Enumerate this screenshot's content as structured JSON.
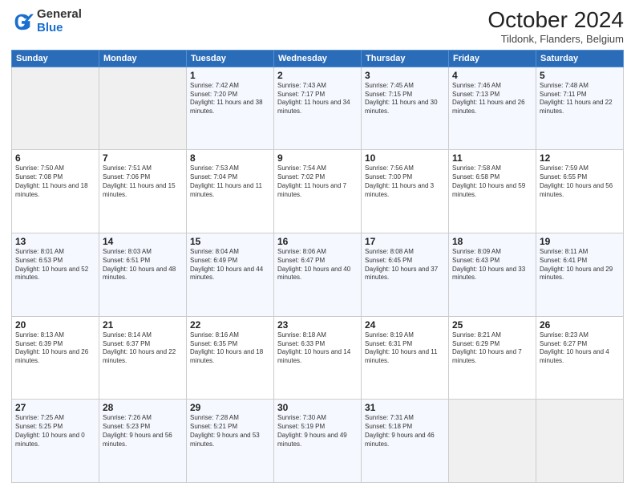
{
  "header": {
    "logo_general": "General",
    "logo_blue": "Blue",
    "month": "October 2024",
    "location": "Tildonk, Flanders, Belgium"
  },
  "days_of_week": [
    "Sunday",
    "Monday",
    "Tuesday",
    "Wednesday",
    "Thursday",
    "Friday",
    "Saturday"
  ],
  "weeks": [
    [
      {
        "day": "",
        "sunrise": "",
        "sunset": "",
        "daylight": "",
        "empty": true
      },
      {
        "day": "",
        "sunrise": "",
        "sunset": "",
        "daylight": "",
        "empty": true
      },
      {
        "day": "1",
        "sunrise": "Sunrise: 7:42 AM",
        "sunset": "Sunset: 7:20 PM",
        "daylight": "Daylight: 11 hours and 38 minutes."
      },
      {
        "day": "2",
        "sunrise": "Sunrise: 7:43 AM",
        "sunset": "Sunset: 7:17 PM",
        "daylight": "Daylight: 11 hours and 34 minutes."
      },
      {
        "day": "3",
        "sunrise": "Sunrise: 7:45 AM",
        "sunset": "Sunset: 7:15 PM",
        "daylight": "Daylight: 11 hours and 30 minutes."
      },
      {
        "day": "4",
        "sunrise": "Sunrise: 7:46 AM",
        "sunset": "Sunset: 7:13 PM",
        "daylight": "Daylight: 11 hours and 26 minutes."
      },
      {
        "day": "5",
        "sunrise": "Sunrise: 7:48 AM",
        "sunset": "Sunset: 7:11 PM",
        "daylight": "Daylight: 11 hours and 22 minutes."
      }
    ],
    [
      {
        "day": "6",
        "sunrise": "Sunrise: 7:50 AM",
        "sunset": "Sunset: 7:08 PM",
        "daylight": "Daylight: 11 hours and 18 minutes."
      },
      {
        "day": "7",
        "sunrise": "Sunrise: 7:51 AM",
        "sunset": "Sunset: 7:06 PM",
        "daylight": "Daylight: 11 hours and 15 minutes."
      },
      {
        "day": "8",
        "sunrise": "Sunrise: 7:53 AM",
        "sunset": "Sunset: 7:04 PM",
        "daylight": "Daylight: 11 hours and 11 minutes."
      },
      {
        "day": "9",
        "sunrise": "Sunrise: 7:54 AM",
        "sunset": "Sunset: 7:02 PM",
        "daylight": "Daylight: 11 hours and 7 minutes."
      },
      {
        "day": "10",
        "sunrise": "Sunrise: 7:56 AM",
        "sunset": "Sunset: 7:00 PM",
        "daylight": "Daylight: 11 hours and 3 minutes."
      },
      {
        "day": "11",
        "sunrise": "Sunrise: 7:58 AM",
        "sunset": "Sunset: 6:58 PM",
        "daylight": "Daylight: 10 hours and 59 minutes."
      },
      {
        "day": "12",
        "sunrise": "Sunrise: 7:59 AM",
        "sunset": "Sunset: 6:55 PM",
        "daylight": "Daylight: 10 hours and 56 minutes."
      }
    ],
    [
      {
        "day": "13",
        "sunrise": "Sunrise: 8:01 AM",
        "sunset": "Sunset: 6:53 PM",
        "daylight": "Daylight: 10 hours and 52 minutes."
      },
      {
        "day": "14",
        "sunrise": "Sunrise: 8:03 AM",
        "sunset": "Sunset: 6:51 PM",
        "daylight": "Daylight: 10 hours and 48 minutes."
      },
      {
        "day": "15",
        "sunrise": "Sunrise: 8:04 AM",
        "sunset": "Sunset: 6:49 PM",
        "daylight": "Daylight: 10 hours and 44 minutes."
      },
      {
        "day": "16",
        "sunrise": "Sunrise: 8:06 AM",
        "sunset": "Sunset: 6:47 PM",
        "daylight": "Daylight: 10 hours and 40 minutes."
      },
      {
        "day": "17",
        "sunrise": "Sunrise: 8:08 AM",
        "sunset": "Sunset: 6:45 PM",
        "daylight": "Daylight: 10 hours and 37 minutes."
      },
      {
        "day": "18",
        "sunrise": "Sunrise: 8:09 AM",
        "sunset": "Sunset: 6:43 PM",
        "daylight": "Daylight: 10 hours and 33 minutes."
      },
      {
        "day": "19",
        "sunrise": "Sunrise: 8:11 AM",
        "sunset": "Sunset: 6:41 PM",
        "daylight": "Daylight: 10 hours and 29 minutes."
      }
    ],
    [
      {
        "day": "20",
        "sunrise": "Sunrise: 8:13 AM",
        "sunset": "Sunset: 6:39 PM",
        "daylight": "Daylight: 10 hours and 26 minutes."
      },
      {
        "day": "21",
        "sunrise": "Sunrise: 8:14 AM",
        "sunset": "Sunset: 6:37 PM",
        "daylight": "Daylight: 10 hours and 22 minutes."
      },
      {
        "day": "22",
        "sunrise": "Sunrise: 8:16 AM",
        "sunset": "Sunset: 6:35 PM",
        "daylight": "Daylight: 10 hours and 18 minutes."
      },
      {
        "day": "23",
        "sunrise": "Sunrise: 8:18 AM",
        "sunset": "Sunset: 6:33 PM",
        "daylight": "Daylight: 10 hours and 14 minutes."
      },
      {
        "day": "24",
        "sunrise": "Sunrise: 8:19 AM",
        "sunset": "Sunset: 6:31 PM",
        "daylight": "Daylight: 10 hours and 11 minutes."
      },
      {
        "day": "25",
        "sunrise": "Sunrise: 8:21 AM",
        "sunset": "Sunset: 6:29 PM",
        "daylight": "Daylight: 10 hours and 7 minutes."
      },
      {
        "day": "26",
        "sunrise": "Sunrise: 8:23 AM",
        "sunset": "Sunset: 6:27 PM",
        "daylight": "Daylight: 10 hours and 4 minutes."
      }
    ],
    [
      {
        "day": "27",
        "sunrise": "Sunrise: 7:25 AM",
        "sunset": "Sunset: 5:25 PM",
        "daylight": "Daylight: 10 hours and 0 minutes."
      },
      {
        "day": "28",
        "sunrise": "Sunrise: 7:26 AM",
        "sunset": "Sunset: 5:23 PM",
        "daylight": "Daylight: 9 hours and 56 minutes."
      },
      {
        "day": "29",
        "sunrise": "Sunrise: 7:28 AM",
        "sunset": "Sunset: 5:21 PM",
        "daylight": "Daylight: 9 hours and 53 minutes."
      },
      {
        "day": "30",
        "sunrise": "Sunrise: 7:30 AM",
        "sunset": "Sunset: 5:19 PM",
        "daylight": "Daylight: 9 hours and 49 minutes."
      },
      {
        "day": "31",
        "sunrise": "Sunrise: 7:31 AM",
        "sunset": "Sunset: 5:18 PM",
        "daylight": "Daylight: 9 hours and 46 minutes."
      },
      {
        "day": "",
        "sunrise": "",
        "sunset": "",
        "daylight": "",
        "empty": true
      },
      {
        "day": "",
        "sunrise": "",
        "sunset": "",
        "daylight": "",
        "empty": true
      }
    ]
  ]
}
